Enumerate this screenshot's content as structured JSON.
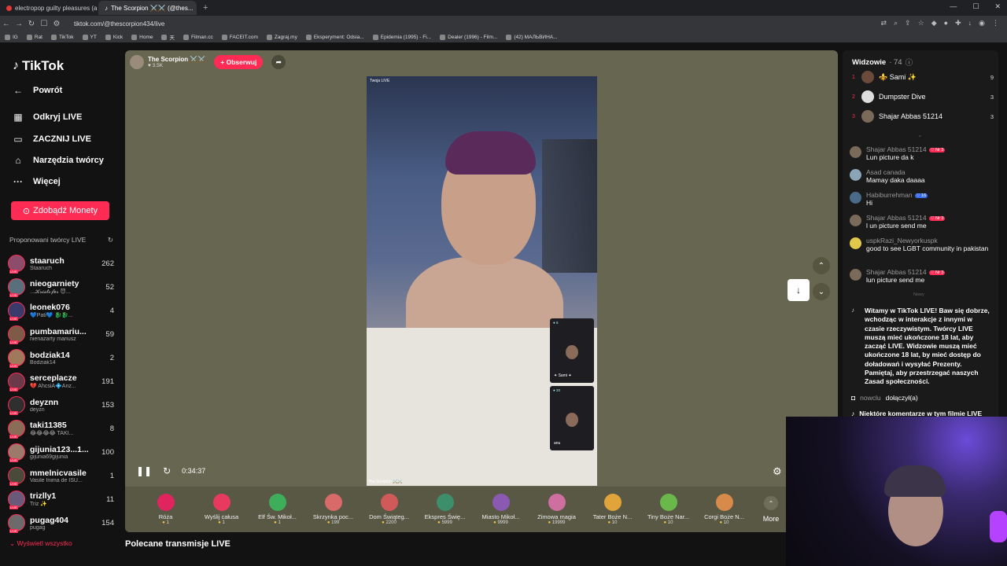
{
  "browser": {
    "tabs": [
      {
        "title": "electropop guilty pleasures (a playlis",
        "active": false
      },
      {
        "title": "The Scorpion ⚔️⚔️ (@thes...",
        "active": true
      }
    ],
    "new_tab": "+",
    "url": "tiktok.com/@thescorpion434/live",
    "bookmarks": [
      "IG",
      "Rat",
      "TikTok",
      "YT",
      "Kick",
      "Home",
      "天",
      "Filman.cc",
      "FACEIT.com",
      "Zagraj.my",
      "Eksperyment: Odsia...",
      "Epidemia (1995) - Fi...",
      "Dealer (1996) - Film...",
      "(42) МАЛЬВИНА..."
    ]
  },
  "sidebar": {
    "logo": "TikTok",
    "back": "Powrót",
    "nav": [
      {
        "label": "Odkryj LIVE",
        "icon": "calendar-icon"
      },
      {
        "label": "ZACZNIJ LIVE",
        "icon": "video-camera-icon"
      },
      {
        "label": "Narzędzia twórcy",
        "icon": "lightbulb-icon"
      },
      {
        "label": "Więcej",
        "icon": "more-dots-icon"
      }
    ],
    "coins_button": "Zdobądź Monety",
    "suggested_title": "Proponowani twórcy LIVE",
    "creators": [
      {
        "name": "staaruch",
        "sub": "Staaruch",
        "count": "262",
        "color": "#8b4d6b"
      },
      {
        "name": "nieogarniety",
        "sub": "...𝓚𝓻𝓲𝓼𝓽𝓸𝓯𝓮𝓻 😈...",
        "count": "52",
        "color": "#5a6f7c"
      },
      {
        "name": "leonek076",
        "sub": "💙Pati💙 🐉🐉...",
        "count": "4",
        "color": "#3b3b6b"
      },
      {
        "name": "pumbamariu...",
        "sub": "nienażarty mariusz",
        "count": "59",
        "color": "#7d5b46"
      },
      {
        "name": "bodziak14",
        "sub": "Bodziak14",
        "count": "2",
        "color": "#a0785a"
      },
      {
        "name": "serceplacze",
        "sub": "💔 AhcsiA💠Anz...",
        "count": "191",
        "color": "#6b3a4a"
      },
      {
        "name": "deyznn",
        "sub": "deyzn",
        "count": "153",
        "color": "#2f2f2f"
      },
      {
        "name": "taki11385",
        "sub": "😂😂😂😂 TAKI...",
        "count": "8",
        "color": "#8a6d57"
      },
      {
        "name": "gijunia123...1...",
        "sub": "gijunia69gijunia",
        "count": "100",
        "color": "#9b7a6b"
      },
      {
        "name": "mmelnicvasile",
        "sub": "Vasile Inima de ISU...",
        "count": "1",
        "color": "#4a4a3a"
      },
      {
        "name": "trizlly1",
        "sub": "Triz ✨",
        "count": "11",
        "color": "#6a5a7a"
      },
      {
        "name": "pugag404",
        "sub": "pugag",
        "count": "154",
        "color": "#6b6b6b"
      }
    ],
    "show_all": "Wyświetl wszystko"
  },
  "stream": {
    "host_name": "The Scorpion ⚔️⚔️",
    "host_likes": "♥ 3.5K",
    "follow": "+ Obserwuj",
    "video_label_top": "Twoja LIVE",
    "video_label_bottom": "The Scorpion ⚔️⚔️",
    "pip1_label": "✦ Sami ✦",
    "pip1_count": "● 8",
    "pip2_label": "anu",
    "pip2_count": "● 20",
    "time": "0:34:37",
    "gifts": [
      {
        "name": "Róża",
        "price": "1",
        "color": "#e0245e"
      },
      {
        "name": "Wyślij całusa",
        "price": "1",
        "color": "#e83a5f"
      },
      {
        "name": "Elf Św. Mikoł...",
        "price": "1",
        "color": "#3fae5a"
      },
      {
        "name": "Skrzynka poc...",
        "price": "199",
        "color": "#d86a6a"
      },
      {
        "name": "Dom Świąteg...",
        "price": "2200",
        "color": "#d05a5a"
      },
      {
        "name": "Ekspres Świę...",
        "price": "5999",
        "color": "#3c8f6a"
      },
      {
        "name": "Miasto Mikoł...",
        "price": "9999",
        "color": "#8a5ab3"
      },
      {
        "name": "Zimowa magia",
        "price": "19999",
        "color": "#cf6fa0"
      },
      {
        "name": "Tater Boże N...",
        "price": "10",
        "color": "#e0a43a"
      },
      {
        "name": "Tiny Boże Nar...",
        "price": "10",
        "color": "#6ab84a"
      },
      {
        "name": "Corgi Boże N...",
        "price": "10",
        "color": "#d88a4a"
      }
    ],
    "more": "More",
    "recommended": "Polecane transmisje LIVE"
  },
  "chat": {
    "viewers_title": "Widzowie",
    "viewers_count": "· 74",
    "top_viewers": [
      {
        "rank": "1",
        "name": "⚜️ Sami ✨",
        "score": "9",
        "color": "#6a4a3a"
      },
      {
        "rank": "2",
        "name": "Dumpster Dive",
        "score": "3",
        "color": "#dddddd"
      },
      {
        "rank": "3",
        "name": "Shajar Abbas 51214",
        "score": "3",
        "color": "#7a6a5a"
      }
    ],
    "messages": [
      {
        "user": "Shajar Abbas 51214",
        "badge": "♡ Nr 3",
        "badge_type": "red",
        "text": "Lun picture da k",
        "color": "#7a6a5a"
      },
      {
        "user": "Asad canada",
        "badge": "",
        "badge_type": "",
        "text": "Mamay daka daaaa",
        "color": "#8aa4b8"
      },
      {
        "user": "Habiburrehman",
        "badge": "♡ 16",
        "badge_type": "blue",
        "text": "Hi",
        "color": "#4a6a8a"
      },
      {
        "user": "Shajar Abbas 51214",
        "badge": "♡ Nr 3",
        "badge_type": "red",
        "text": "l un picture send me",
        "color": "#7a6a5a"
      },
      {
        "user": "uspkRazi_Newyorkuspk",
        "badge": "",
        "badge_type": "",
        "text": "good to see LGBT community in pakistan",
        "color": "#e0c84a"
      },
      {
        "user": "Shajar Abbas 51214",
        "badge": "♡ Nr 3",
        "badge_type": "red",
        "text": "lun picture send me",
        "color": "#7a6a5a"
      }
    ],
    "new_label": "Nowy",
    "system_message": "Witamy w TikTok LIVE! Baw się dobrze, wchodząc w interakcje z innymi w czasie rzeczywistym. Twórcy LIVE muszą mieć ukończone 18 lat, aby zacząć LIVE. Widzowie muszą mieć ukończone 18 lat, by mieć dostęp do doładowań i wysyłać Prezenty. Pamiętaj, aby przestrzegać naszych Zasad społeczności.",
    "join_user": "nowclu",
    "join_text": "dołączył(a)",
    "info_text": "Niektóre komentarze w tym filmie LIVE"
  }
}
